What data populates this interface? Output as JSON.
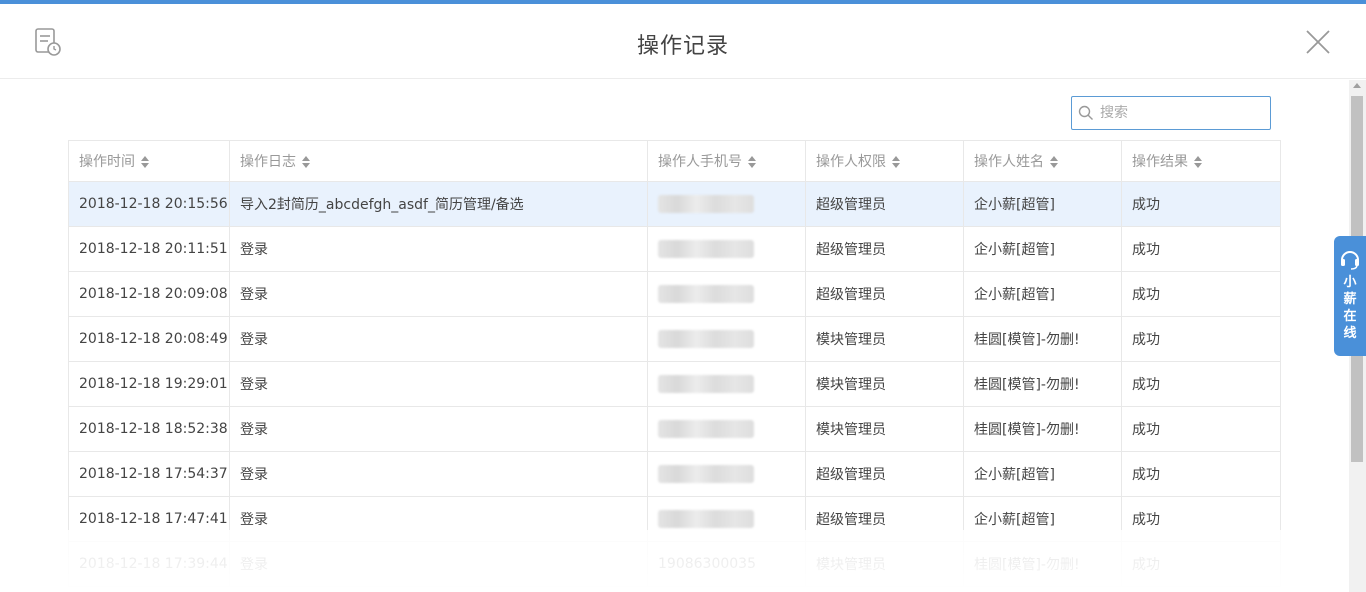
{
  "dialog": {
    "title": "操作记录",
    "icons": {
      "header": "log-record-icon",
      "close": "close-icon"
    }
  },
  "search": {
    "placeholder": "搜索",
    "value": ""
  },
  "table": {
    "headers": [
      "操作时间",
      "操作日志",
      "操作人手机号",
      "操作人权限",
      "操作人姓名",
      "操作结果"
    ],
    "rows": [
      {
        "time": "2018-12-18 20:15:56",
        "log": "导入2封简历_abcdefgh_asdf_简历管理/备选",
        "phone": "",
        "role": "超级管理员",
        "name": "企小薪[超管]",
        "result": "成功"
      },
      {
        "time": "2018-12-18 20:11:51",
        "log": "登录",
        "phone": "",
        "role": "超级管理员",
        "name": "企小薪[超管]",
        "result": "成功"
      },
      {
        "time": "2018-12-18 20:09:08",
        "log": "登录",
        "phone": "",
        "role": "超级管理员",
        "name": "企小薪[超管]",
        "result": "成功"
      },
      {
        "time": "2018-12-18 20:08:49",
        "log": "登录",
        "phone": "",
        "role": "模块管理员",
        "name": "桂圆[模管]-勿删!",
        "result": "成功"
      },
      {
        "time": "2018-12-18 19:29:01",
        "log": "登录",
        "phone": "",
        "role": "模块管理员",
        "name": "桂圆[模管]-勿删!",
        "result": "成功"
      },
      {
        "time": "2018-12-18 18:52:38",
        "log": "登录",
        "phone": "",
        "role": "模块管理员",
        "name": "桂圆[模管]-勿删!",
        "result": "成功"
      },
      {
        "time": "2018-12-18 17:54:37",
        "log": "登录",
        "phone": "",
        "role": "超级管理员",
        "name": "企小薪[超管]",
        "result": "成功"
      },
      {
        "time": "2018-12-18 17:47:41",
        "log": "登录",
        "phone": "",
        "role": "超级管理员",
        "name": "企小薪[超管]",
        "result": "成功"
      },
      {
        "time": "2018-12-18 17:39:44",
        "log": "登录",
        "phone": "19086300035",
        "role": "模块管理员",
        "name": "桂圆[模管]-勿删!",
        "result": "成功"
      }
    ]
  },
  "helper": {
    "label": "小薪在线",
    "icon": "headset-icon"
  },
  "colors": {
    "accent": "#4a90d9",
    "selected_row": "#e9f2fd"
  }
}
